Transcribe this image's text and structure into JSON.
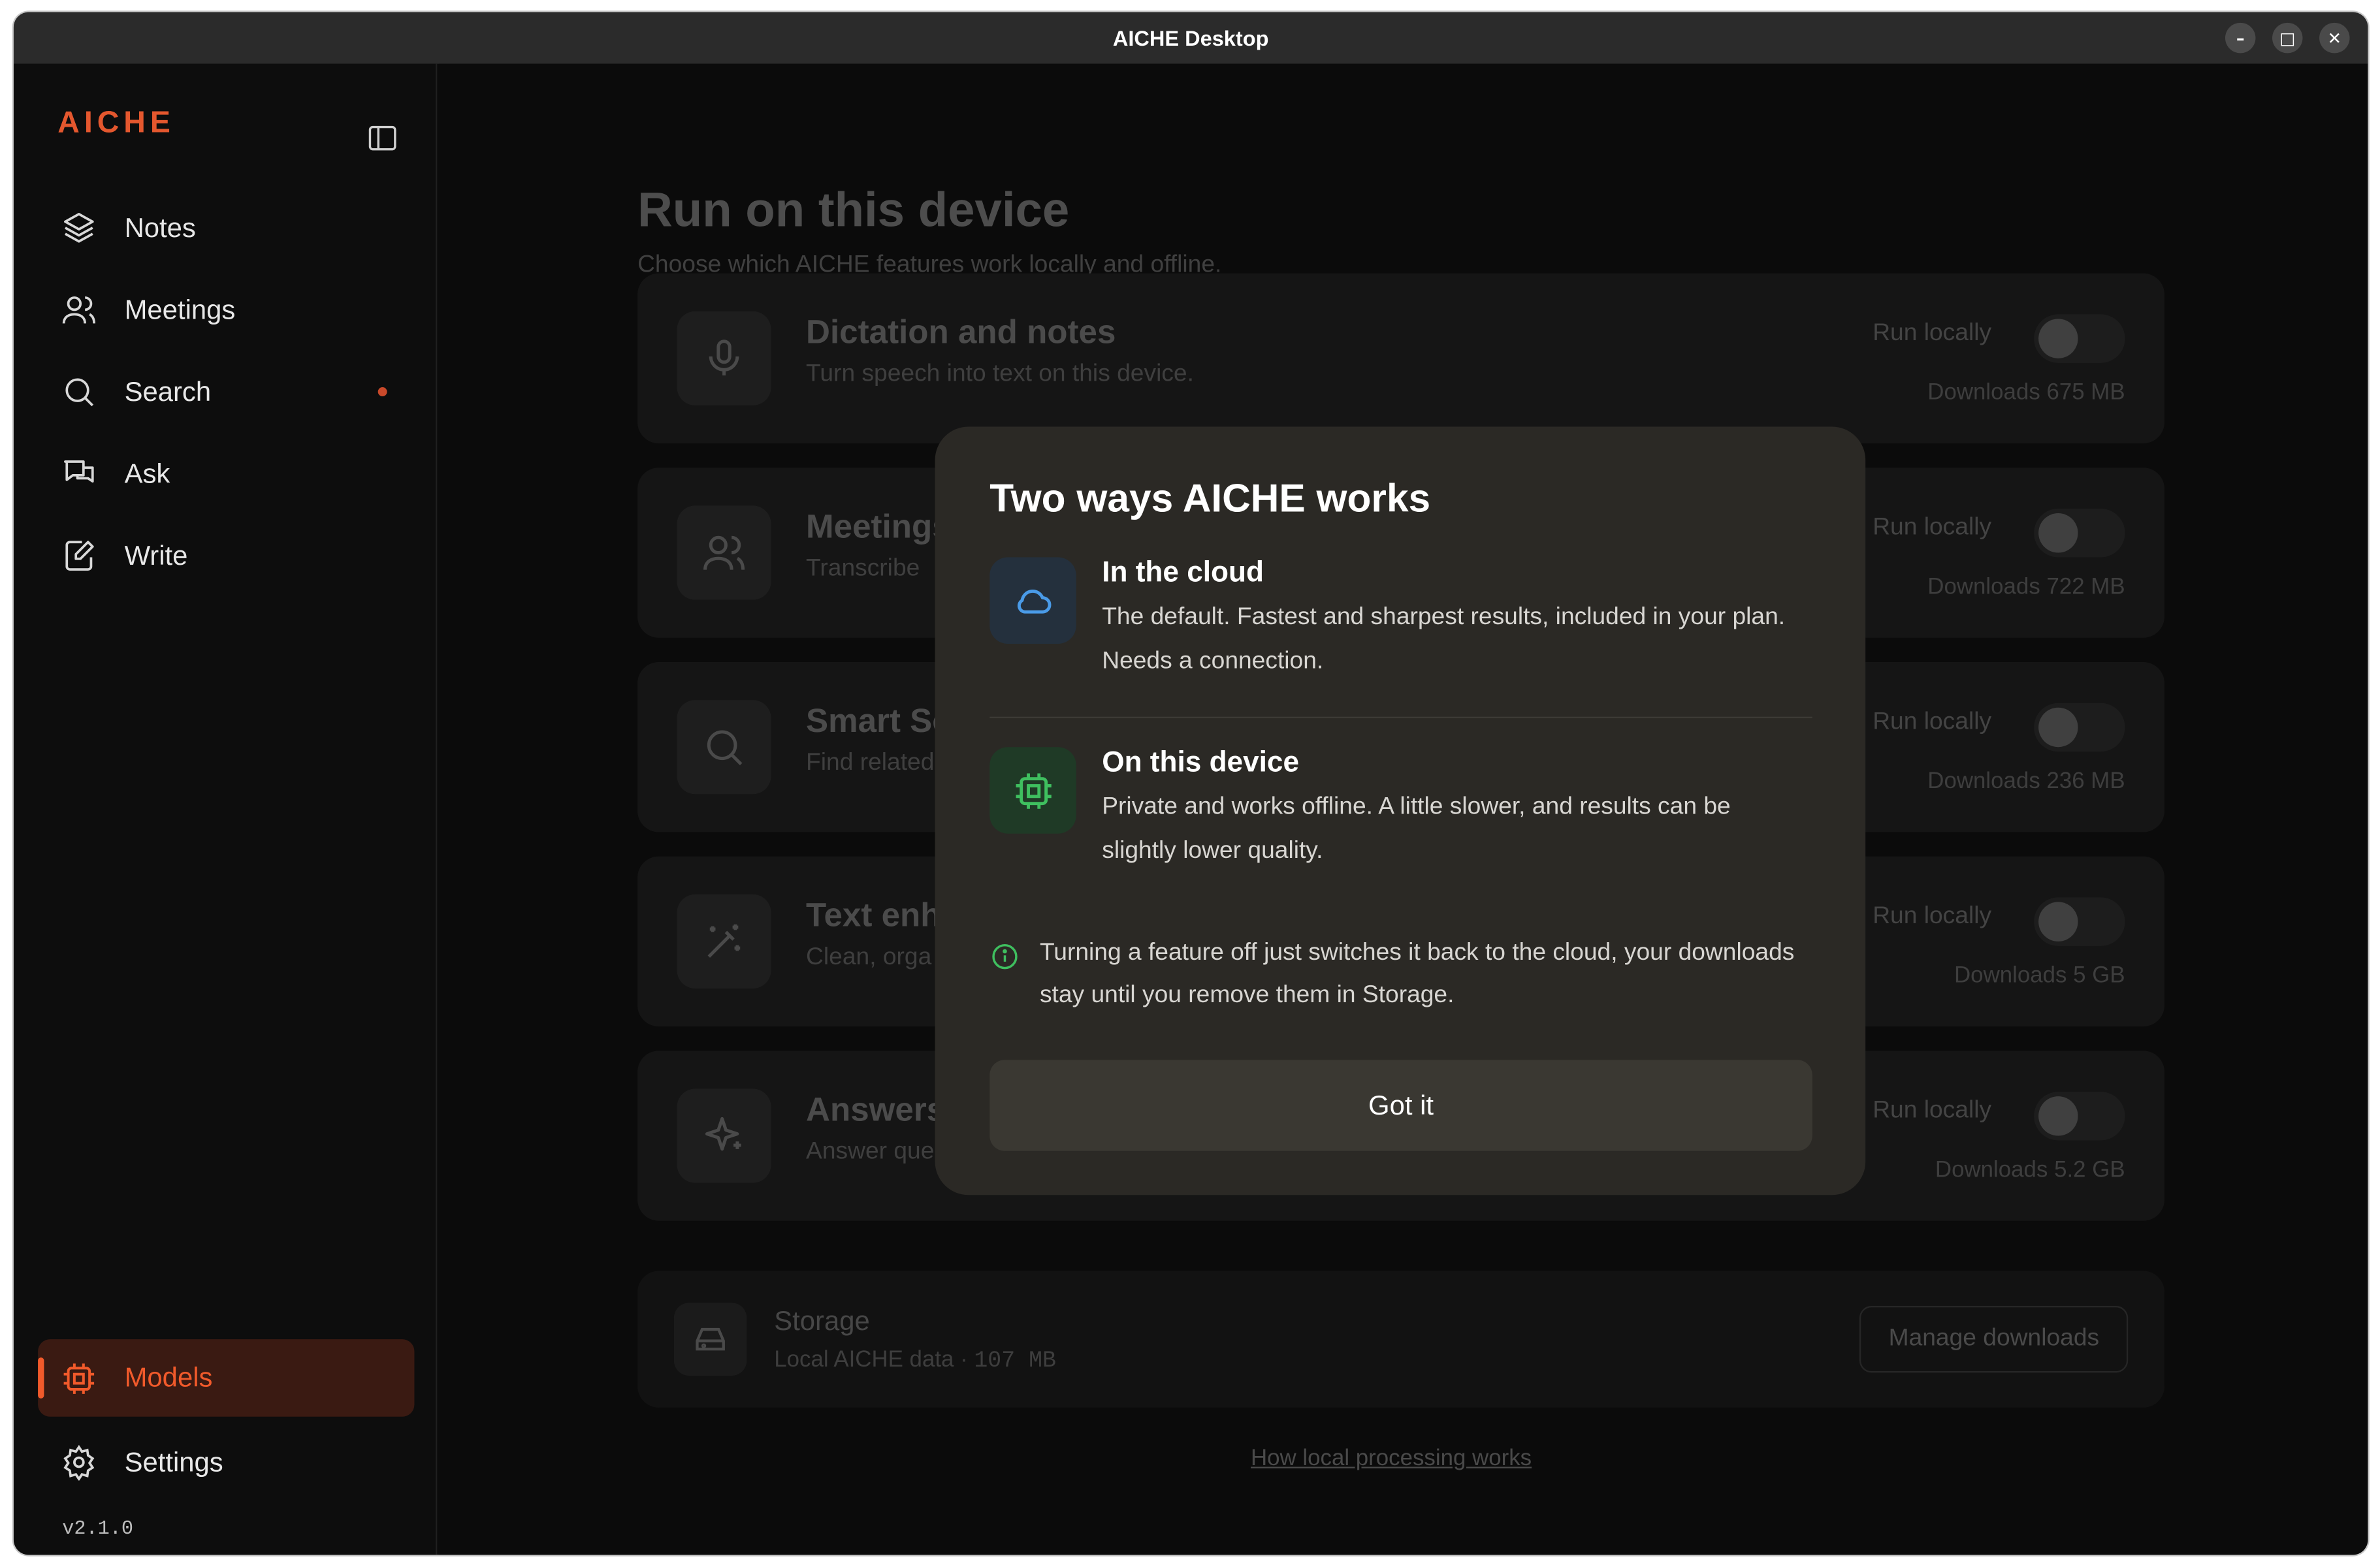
{
  "window": {
    "title": "AICHE Desktop",
    "minimize": "–",
    "maximize": "□",
    "close": "✕"
  },
  "sidebar": {
    "brand": "AICHE",
    "items": [
      {
        "label": "Notes",
        "icon": "layers-icon"
      },
      {
        "label": "Meetings",
        "icon": "users-icon"
      },
      {
        "label": "Search",
        "icon": "search-icon",
        "badge_dot": true
      },
      {
        "label": "Ask",
        "icon": "chat-icon"
      },
      {
        "label": "Write",
        "icon": "edit-icon"
      }
    ],
    "bottom_items": [
      {
        "label": "Models",
        "icon": "chip-icon",
        "active": true
      },
      {
        "label": "Settings",
        "icon": "gear-icon"
      }
    ],
    "version": "v2.1.0"
  },
  "main": {
    "title": "Run on this device",
    "subtitle": "Choose which AICHE features work locally and offline.",
    "features": [
      {
        "title": "Dictation and notes",
        "desc": "Turn speech into text on this device.",
        "run_label": "Run locally",
        "download": "Downloads 675 MB",
        "icon": "mic-icon",
        "enabled": false
      },
      {
        "title": "Meetings",
        "desc": "Transcribe",
        "run_label": "Run locally",
        "download": "Downloads 722 MB",
        "icon": "users-icon",
        "enabled": false
      },
      {
        "title": "Smart Se",
        "desc": "Find related",
        "run_label": "Run locally",
        "download": "Downloads 236 MB",
        "icon": "search-icon",
        "enabled": false
      },
      {
        "title": "Text enh",
        "desc": "Clean, orga",
        "run_label": "Run locally",
        "download": "Downloads 5 GB",
        "icon": "wand-icon",
        "enabled": false
      },
      {
        "title": "Answers",
        "desc": "Answer que",
        "run_label": "Run locally",
        "download": "Downloads 5.2 GB",
        "icon": "sparkle-icon",
        "enabled": false
      }
    ],
    "storage": {
      "title": "Storage",
      "subtitle_prefix": "Local AICHE data · ",
      "size": "107 MB",
      "button": "Manage downloads"
    },
    "link": "How local processing works"
  },
  "modal": {
    "title": "Two ways AICHE works",
    "cloud": {
      "heading": "In the cloud",
      "text": "The default. Fastest and sharpest results, included in your plan. Needs a connection.",
      "icon": "cloud-icon",
      "color": "#4a9be8"
    },
    "device": {
      "heading": "On this device",
      "text": "Private and works offline. A little slower, and results can be slightly lower quality.",
      "icon": "chip-icon",
      "color": "#3fbf5f"
    },
    "info": "Turning a feature off just switches it back to the cloud, your downloads stay until you remove them in Storage.",
    "button": "Got it"
  },
  "colors": {
    "accent": "#f15a2b",
    "cloud": "#4a9be8",
    "device": "#3fbf5f"
  }
}
